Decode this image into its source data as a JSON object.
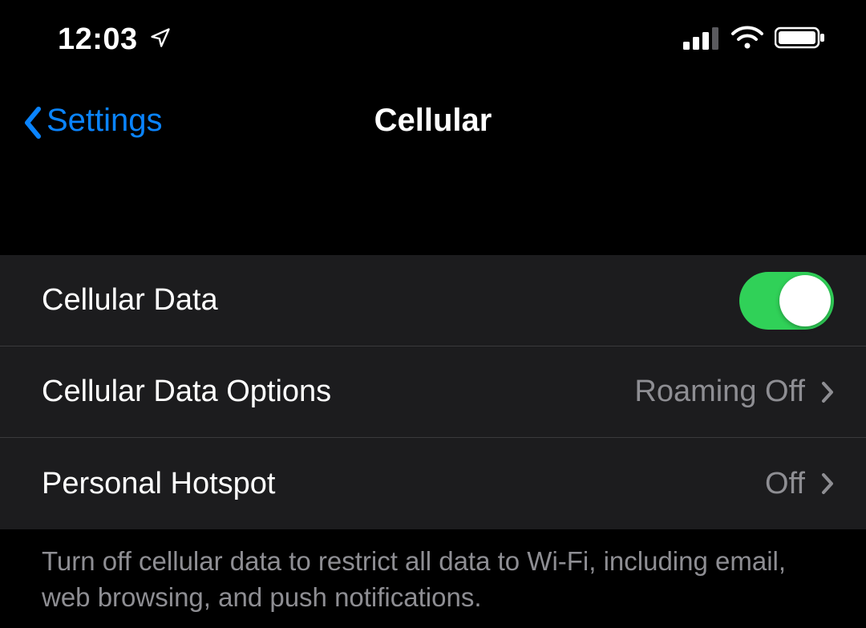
{
  "status": {
    "time": "12:03"
  },
  "nav": {
    "back_label": "Settings",
    "title": "Cellular"
  },
  "rows": {
    "cellular_data": {
      "label": "Cellular Data"
    },
    "cellular_data_options": {
      "label": "Cellular Data Options",
      "value": "Roaming Off"
    },
    "personal_hotspot": {
      "label": "Personal Hotspot",
      "value": "Off"
    }
  },
  "footer": "Turn off cellular data to restrict all data to Wi-Fi, including email, web browsing, and push notifications."
}
